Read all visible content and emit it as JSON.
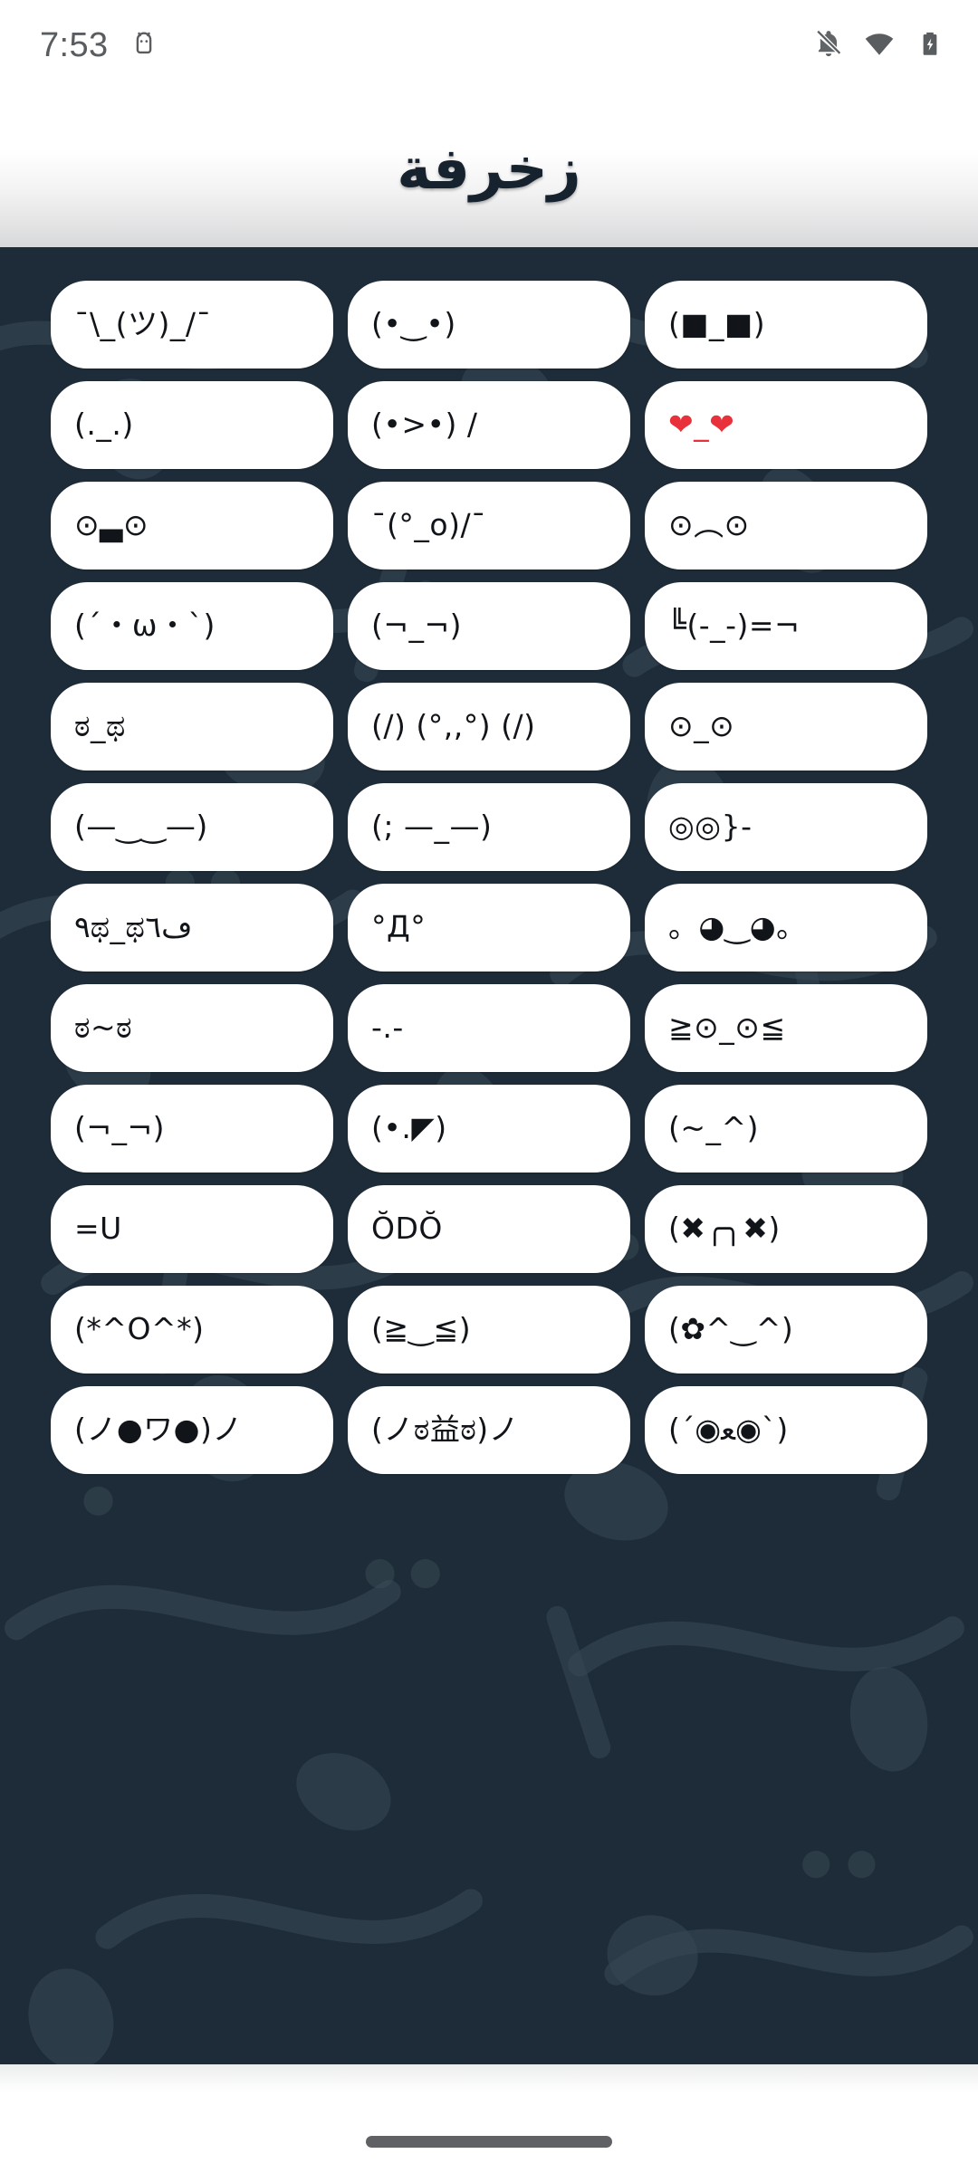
{
  "status_bar": {
    "time": "7:53",
    "icons": [
      {
        "name": "android-robot-icon"
      },
      {
        "name": "notifications-off-icon"
      },
      {
        "name": "wifi-icon"
      },
      {
        "name": "battery-charging-icon"
      }
    ]
  },
  "header": {
    "title": "زخرفة"
  },
  "theme": {
    "background": "#1d2c38",
    "chip_background": "#ffffff",
    "chip_text": "#111418",
    "accent_red": "#e8313a",
    "header_text": "#16222e",
    "status_text": "#5a5d60"
  },
  "nav_bar": {
    "handle": "gesture-pill"
  },
  "kaomoji_grid": {
    "columns": 3,
    "items": [
      {
        "text": "¯\\_(ツ)_/¯",
        "color": "default"
      },
      {
        "text": "(•‿•)",
        "color": "default"
      },
      {
        "text": "(■_■)",
        "color": "default"
      },
      {
        "text": "(._.)",
        "color": "default"
      },
      {
        "text": "(•>•) /",
        "color": "default"
      },
      {
        "text": "❤_❤",
        "color": "red"
      },
      {
        "text": "⊙▃⊙",
        "color": "default"
      },
      {
        "text": "¯(°_o)/¯",
        "color": "default"
      },
      {
        "text": "⊙︵⊙",
        "color": "default"
      },
      {
        "text": "(´・ω・`)",
        "color": "default"
      },
      {
        "text": "(¬_¬)",
        "color": "default"
      },
      {
        "text": "╚(-_-)=¬",
        "color": "default"
      },
      {
        "text": "ಠ_ಥ",
        "color": "default"
      },
      {
        "text": "(/) (°,,°) (/)",
        "color": "default"
      },
      {
        "text": "⊙_⊙",
        "color": "default"
      },
      {
        "text": "(—‿‿—)",
        "color": "default"
      },
      {
        "text": "(; —_—)",
        "color": "default"
      },
      {
        "text": "◎◎}-",
        "color": "default"
      },
      {
        "text": "٩ಥ_ಥڡ٦",
        "color": "default"
      },
      {
        "text": "°Д°",
        "color": "default"
      },
      {
        "text": "。◕‿◕。",
        "color": "default"
      },
      {
        "text": "ಠ~ಠ",
        "color": "default"
      },
      {
        "text": "-.-",
        "color": "default"
      },
      {
        "text": "≧⊙_⊙≦",
        "color": "default"
      },
      {
        "text": "(¬_¬)",
        "color": "default"
      },
      {
        "text": "(•.◤)",
        "color": "default"
      },
      {
        "text": "(~_^)",
        "color": "default"
      },
      {
        "text": "=U",
        "color": "default"
      },
      {
        "text": "ŎDŎ",
        "color": "default"
      },
      {
        "text": "(✖╭╮✖)",
        "color": "default"
      },
      {
        "text": "(*^O^*)",
        "color": "default"
      },
      {
        "text": "(≧‿≦)",
        "color": "default"
      },
      {
        "text": "(✿^‿^)",
        "color": "default"
      },
      {
        "text": "(ノ●ワ●)ノ",
        "color": "default"
      },
      {
        "text": "(ノಠ益ಠ)ノ",
        "color": "default"
      },
      {
        "text": "(´◉ﻌ◉`)",
        "color": "default"
      }
    ]
  }
}
